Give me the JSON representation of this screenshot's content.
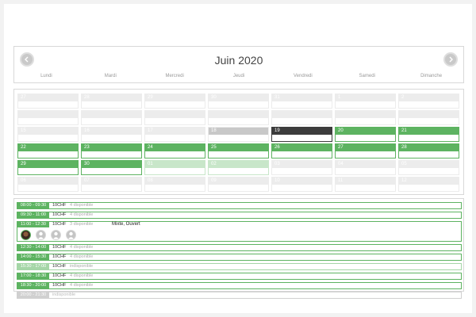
{
  "calendar": {
    "month_title": "Juin 2020",
    "weekdays": [
      "Lundi",
      "Mardi",
      "Mercredi",
      "Jeudi",
      "Vendredi",
      "Samedi",
      "Dimanche"
    ],
    "days": [
      {
        "n": "27",
        "state": "other"
      },
      {
        "n": "28",
        "state": "other"
      },
      {
        "n": "29",
        "state": "other"
      },
      {
        "n": "30",
        "state": "other"
      },
      {
        "n": "31",
        "state": "other"
      },
      {
        "n": "1",
        "state": "other"
      },
      {
        "n": "2",
        "state": "other"
      },
      {
        "n": "",
        "state": "other"
      },
      {
        "n": "",
        "state": "other"
      },
      {
        "n": "",
        "state": "other"
      },
      {
        "n": "",
        "state": "other"
      },
      {
        "n": "",
        "state": "other"
      },
      {
        "n": "",
        "state": "other"
      },
      {
        "n": "",
        "state": "other"
      },
      {
        "n": "15",
        "state": "other"
      },
      {
        "n": "16",
        "state": "other"
      },
      {
        "n": "17",
        "state": "other"
      },
      {
        "n": "18",
        "state": "past"
      },
      {
        "n": "19",
        "state": "today"
      },
      {
        "n": "20",
        "state": "available"
      },
      {
        "n": "21",
        "state": "available"
      },
      {
        "n": "22",
        "state": "available"
      },
      {
        "n": "23",
        "state": "available"
      },
      {
        "n": "24",
        "state": "available"
      },
      {
        "n": "25",
        "state": "available"
      },
      {
        "n": "26",
        "state": "available"
      },
      {
        "n": "27",
        "state": "available"
      },
      {
        "n": "28",
        "state": "available"
      },
      {
        "n": "29",
        "state": "available"
      },
      {
        "n": "30",
        "state": "available"
      },
      {
        "n": "01",
        "state": "light"
      },
      {
        "n": "02",
        "state": "light"
      },
      {
        "n": "03",
        "state": "other"
      },
      {
        "n": "04",
        "state": "other"
      },
      {
        "n": "05",
        "state": "other"
      },
      {
        "n": "06",
        "state": "other"
      },
      {
        "n": "07",
        "state": "other"
      },
      {
        "n": "08",
        "state": "other"
      },
      {
        "n": "09",
        "state": "other"
      },
      {
        "n": "10",
        "state": "other"
      },
      {
        "n": "11",
        "state": "other"
      },
      {
        "n": "12",
        "state": "other"
      }
    ]
  },
  "slots": [
    {
      "time": "08:00 - 09:30",
      "price": "10CHF",
      "status": "4 disponible",
      "style": "green"
    },
    {
      "time": "09:30 - 11:00",
      "price": "10CHF",
      "status": "4 disponible",
      "style": "green"
    },
    {
      "time": "11:00 - 12:30",
      "price": "10CHF",
      "status": "3 disponible",
      "style": "green",
      "match": "Mixte, Ouvert",
      "players": [
        "filled",
        "empty",
        "empty",
        "empty"
      ]
    },
    {
      "time": "12:30 - 14:00",
      "price": "10CHF",
      "status": "4 disponible",
      "style": "green"
    },
    {
      "time": "14:00 - 15:30",
      "price": "10CHF",
      "status": "4 disponible",
      "style": "green"
    },
    {
      "time": "15:30 - 17:00",
      "price": "10CHF",
      "status": "indisponible",
      "style": "dim"
    },
    {
      "time": "17:00 - 18:30",
      "price": "10CHF",
      "status": "4 disponible",
      "style": "green"
    },
    {
      "time": "18:30 - 20:00",
      "price": "10CHF",
      "status": "4 disponible",
      "style": "green"
    },
    {
      "time": "20:00 - 21:30",
      "price": "",
      "status": "indisponible",
      "style": "grey"
    }
  ],
  "colors": {
    "accent": "#5db361",
    "today": "#3c3c3c",
    "past": "#c8c8c8",
    "light": "#c8e6c9"
  },
  "icons": {
    "prev": "chevron-left-icon",
    "next": "chevron-right-icon",
    "player": "user-avatar-icon"
  }
}
